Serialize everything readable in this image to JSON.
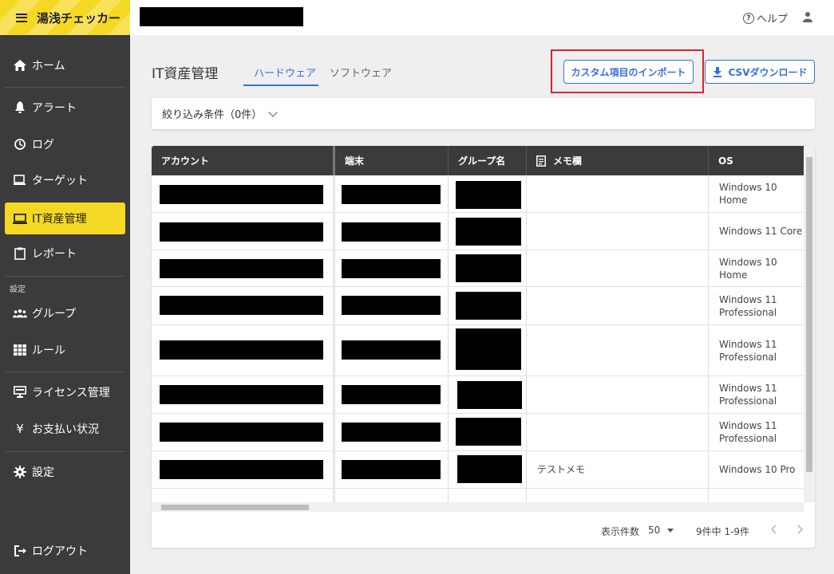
{
  "app": {
    "title": "湯浅チェッカー"
  },
  "header": {
    "help_label": "ヘルプ"
  },
  "sidebar": {
    "items": [
      {
        "label": "ホーム",
        "icon": "home-icon"
      },
      {
        "label": "アラート",
        "icon": "bell-icon"
      },
      {
        "label": "ログ",
        "icon": "history-icon"
      },
      {
        "label": "ターゲット",
        "icon": "computer-icon"
      },
      {
        "label": "IT資産管理",
        "icon": "laptop-icon",
        "active": true
      },
      {
        "label": "レポート",
        "icon": "clipboard-icon"
      },
      {
        "label": "グループ",
        "icon": "people-icon"
      },
      {
        "label": "ルール",
        "icon": "grid-icon"
      },
      {
        "label": "ライセンス管理",
        "icon": "monitor-icon"
      },
      {
        "label": "お支払い状況",
        "icon": "yen-icon"
      },
      {
        "label": "設定",
        "icon": "gear-icon"
      },
      {
        "label": "ログアウト",
        "icon": "logout-icon"
      }
    ],
    "section_label": "設定"
  },
  "main": {
    "title": "IT資産管理",
    "tabs": [
      {
        "label": "ハードウェア",
        "active": true
      },
      {
        "label": "ソフトウェア",
        "active": false
      }
    ],
    "import_button": "カスタム項目のインポート",
    "csv_button": "CSVダウンロード",
    "filter_label": "絞り込み条件（0件）"
  },
  "table": {
    "columns": [
      "アカウント",
      "端末",
      "グループ名",
      "メモ欄",
      "OS"
    ],
    "rows": [
      {
        "memo": "",
        "os": "Windows 10 Home"
      },
      {
        "memo": "",
        "os": "Windows 11 Core"
      },
      {
        "memo": "",
        "os": "Windows 10 Home"
      },
      {
        "memo": "",
        "os": "Windows 11\nProfessional"
      },
      {
        "memo": "",
        "os": "Windows 11\nProfessional"
      },
      {
        "memo": "",
        "os": "Windows 11\nProfessional"
      },
      {
        "memo": "",
        "os": "Windows 11\nProfessional"
      },
      {
        "memo": "テストメモ",
        "os": "Windows 10 Pro"
      }
    ]
  },
  "pager": {
    "per_page_label": "表示件数",
    "per_page_value": "50",
    "range_text": "9件中 1-9件"
  },
  "colors": {
    "accent": "#3a6fd8",
    "brand": "#f5d823",
    "sidebar": "#3b3b3b",
    "highlight": "#e0202a"
  }
}
